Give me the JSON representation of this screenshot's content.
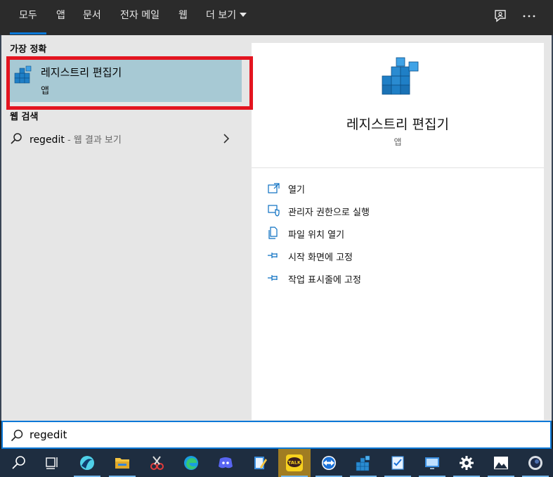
{
  "top_bar": {
    "tabs": [
      {
        "label": "모두",
        "active": true
      },
      {
        "label": "앱"
      },
      {
        "label": "문서"
      },
      {
        "label": "전자 메일"
      },
      {
        "label": "웹"
      },
      {
        "label": "더 보기"
      }
    ],
    "icons": [
      "feedback-icon",
      "more-options-icon"
    ],
    "accent": "#0a78d7"
  },
  "best_match": {
    "section_title": "가장 정확",
    "item": {
      "name": "레지스트리 편집기",
      "type": "앱",
      "icon": "registry-editor-icon"
    },
    "highlight_color": "#a7c9d4",
    "annotation_color": "#e3141f"
  },
  "web_search": {
    "section_title": "웹 검색",
    "query": "regedit",
    "hint": " - 웹 결과 보기"
  },
  "detail": {
    "app_name": "레지스트리 편집기",
    "app_type": "앱",
    "actions": [
      {
        "label": "열기",
        "icon": "open-icon"
      },
      {
        "label": "관리자 권한으로 실행",
        "icon": "shield-icon"
      },
      {
        "label": "파일 위치 열기",
        "icon": "file-location-icon"
      },
      {
        "label": "시작 화면에 고정",
        "icon": "pin-icon"
      },
      {
        "label": "작업 표시줄에 고정",
        "icon": "pin-icon"
      }
    ]
  },
  "search": {
    "value": "regedit"
  },
  "taskbar": {
    "items": [
      "search-icon",
      "task-view-icon",
      "browser-icon",
      "file-explorer-icon",
      "snipping-tool-icon",
      "edge-icon",
      "discord-icon",
      "notepad-icon",
      "kakaotalk-icon",
      "teamviewer-icon",
      "registry-editor-icon",
      "checklist-app-icon",
      "remote-desktop-icon",
      "settings-icon",
      "photos-icon",
      "cinema4d-icon"
    ],
    "kakao_label": "TALK"
  }
}
